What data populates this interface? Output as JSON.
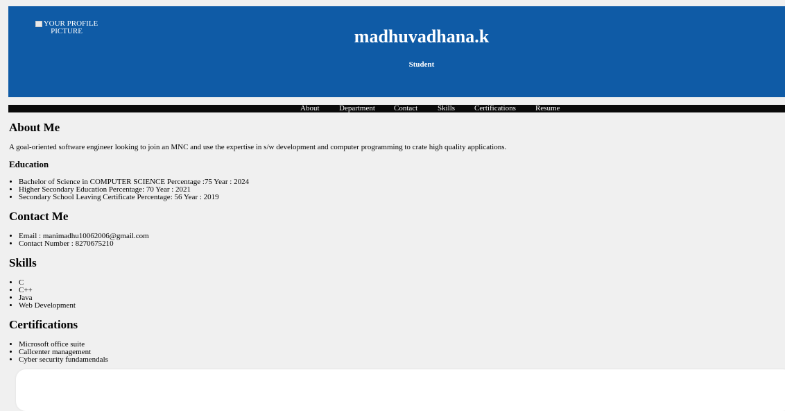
{
  "header": {
    "profile_picture_alt": "YOUR PROFILE PICTURE",
    "name": "madhuvadhana.k",
    "role": "Student",
    "background_color": "#0f5ba6"
  },
  "nav": {
    "items": [
      "About",
      "Department",
      "Contact",
      "Skills",
      "Certifications",
      "Resume"
    ]
  },
  "about": {
    "heading": "About Me",
    "text": "A goal-oriented software engineer looking to join an MNC and use the expertise in s/w development and computer programming to crate high quality applications."
  },
  "education": {
    "heading": "Education",
    "items": [
      "Bachelor of Science in COMPUTER SCIENCE Percentage :75 Year : 2024",
      "Higher Secondary Education Percentage: 70 Year : 2021",
      "Secondary School Leaving Certificate Percentage: 56 Year : 2019"
    ]
  },
  "contact": {
    "heading": "Contact Me",
    "items": [
      "Email : manimadhu10062006@gmail.com",
      "Contact Number : 8270675210"
    ]
  },
  "skills": {
    "heading": "Skills",
    "items": [
      "C",
      "C++",
      "Java",
      "Web Development"
    ]
  },
  "certifications": {
    "heading": "Certifications",
    "items": [
      "Microsoft office suite",
      "Callcenter management",
      "Cyber security fundamendals"
    ]
  }
}
